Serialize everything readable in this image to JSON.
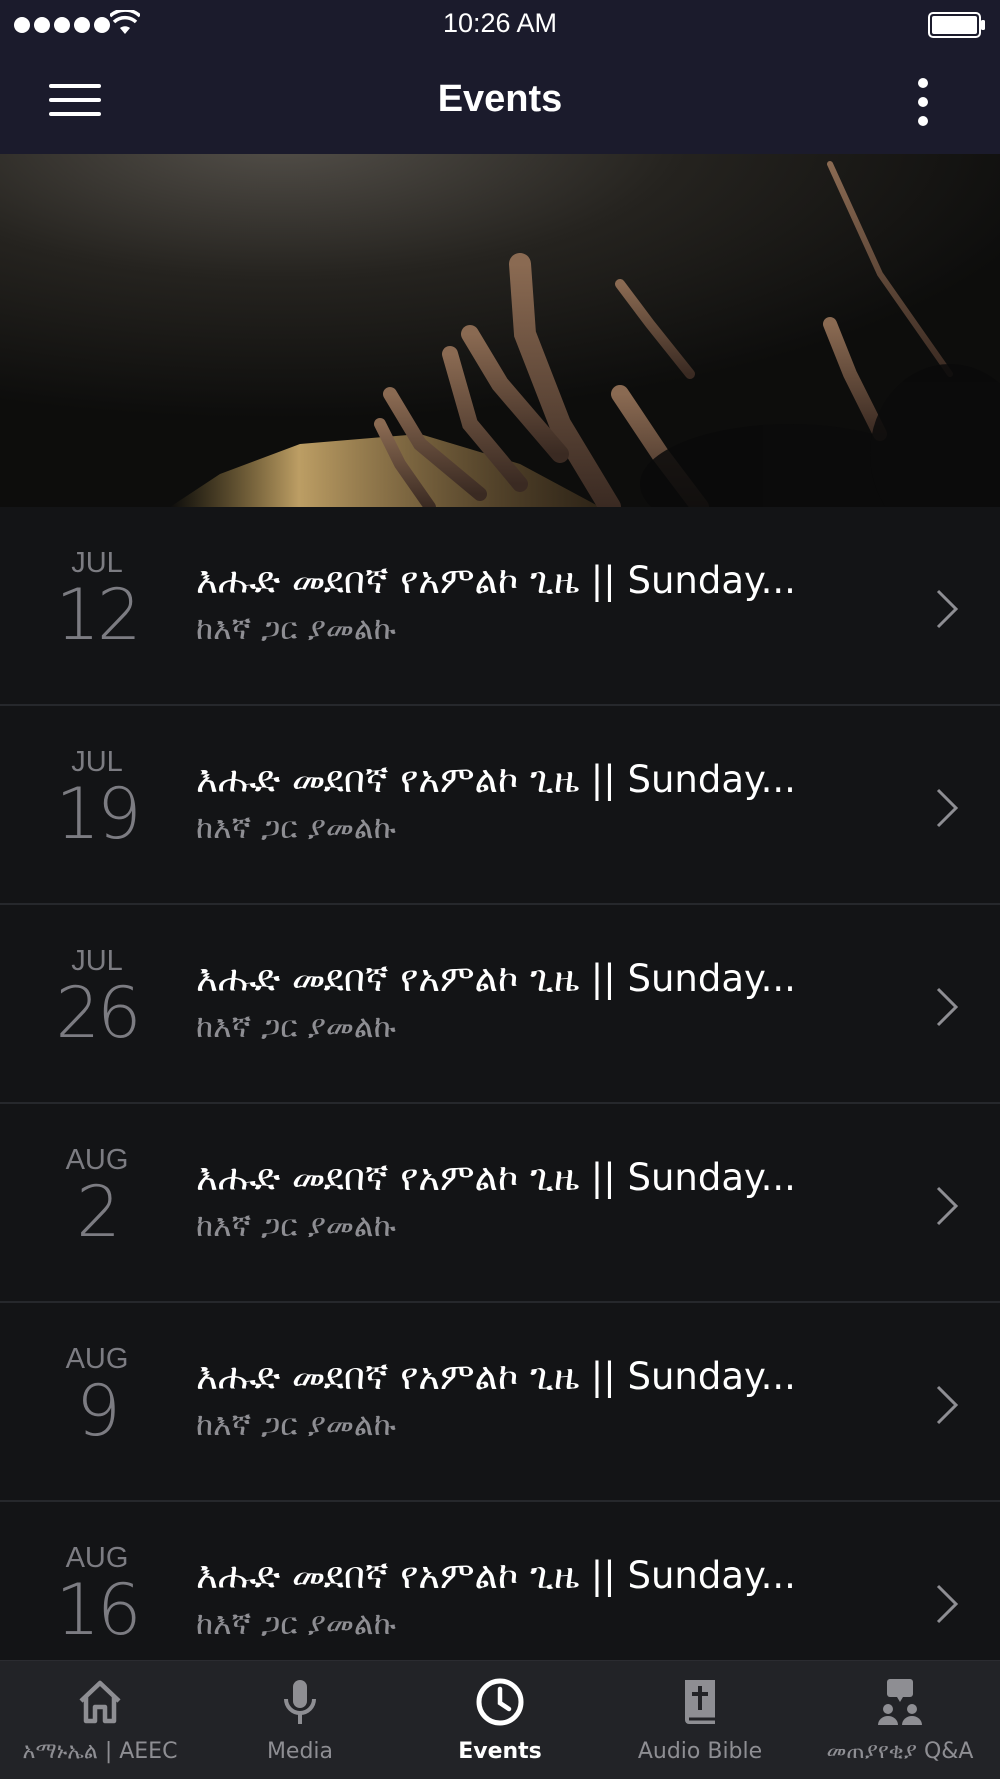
{
  "status_bar": {
    "time": "10:26 AM"
  },
  "nav": {
    "title": "Events"
  },
  "events": [
    {
      "month": "JUL",
      "day": "12",
      "title": "እሑድ መደበኛ የአምልኮ ጊዜ || Sunday...",
      "subtitle": "ከእኛ ጋር ያመልኩ"
    },
    {
      "month": "JUL",
      "day": "19",
      "title": "እሑድ መደበኛ የአምልኮ ጊዜ || Sunday...",
      "subtitle": "ከእኛ ጋር ያመልኩ"
    },
    {
      "month": "JUL",
      "day": "26",
      "title": "እሑድ መደበኛ የአምልኮ ጊዜ || Sunday...",
      "subtitle": "ከእኛ ጋር ያመልኩ"
    },
    {
      "month": "AUG",
      "day": "2",
      "title": "እሑድ መደበኛ የአምልኮ ጊዜ || Sunday...",
      "subtitle": "ከእኛ ጋር ያመልኩ"
    },
    {
      "month": "AUG",
      "day": "9",
      "title": "እሑድ መደበኛ የአምልኮ ጊዜ || Sunday...",
      "subtitle": "ከእኛ ጋር ያመልኩ"
    },
    {
      "month": "AUG",
      "day": "16",
      "title": "እሑድ መደበኛ የአምልኮ ጊዜ || Sunday...",
      "subtitle": "ከእኛ ጋር ያመልኩ"
    }
  ],
  "tabs": [
    {
      "label": "አማኑኤል | AEEC",
      "icon": "home-icon",
      "active": false
    },
    {
      "label": "Media",
      "icon": "microphone-icon",
      "active": false
    },
    {
      "label": "Events",
      "icon": "clock-icon",
      "active": true
    },
    {
      "label": "Audio Bible",
      "icon": "bible-icon",
      "active": false
    },
    {
      "label": "መጠያየቂያ Q&A",
      "icon": "q-and-a-icon",
      "active": false
    }
  ],
  "colors": {
    "header_bg": "#1b1b2c",
    "list_bg": "#131416",
    "tab_bar_bg": "#222327",
    "date_text": "#7c7c82",
    "subtitle_text": "#8e8e93",
    "active_tab": "#ffffff"
  }
}
